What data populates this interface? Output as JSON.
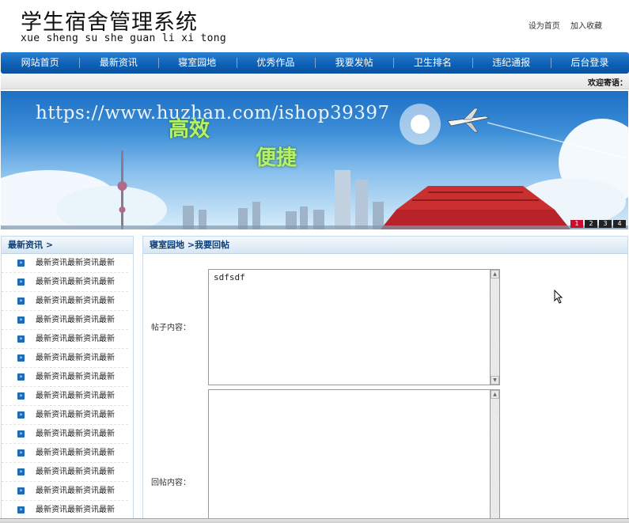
{
  "header": {
    "title": "学生宿舍管理系统",
    "pinyin": "xue sheng su she guan li xi tong",
    "links": [
      "设为首页",
      "加入收藏"
    ]
  },
  "nav": {
    "items": [
      "网站首页",
      "最新资讯",
      "寝室园地",
      "优秀作品",
      "我要发帖",
      "卫生排名",
      "违纪通报",
      "后台登录"
    ]
  },
  "welcome": {
    "text": "欢迎寄语："
  },
  "banner": {
    "watermark": "https://www.huzhan.com/ishop39397",
    "word1": "高效",
    "word2": "便捷",
    "slides": [
      "1",
      "2",
      "3",
      "4"
    ],
    "active_slide": 1
  },
  "sidebar": {
    "title": "最新资讯 >",
    "items": [
      "最新资讯最新资讯最新",
      "最新资讯最新资讯最新",
      "最新资讯最新资讯最新",
      "最新资讯最新资讯最新",
      "最新资讯最新资讯最新",
      "最新资讯最新资讯最新",
      "最新资讯最新资讯最新",
      "最新资讯最新资讯最新",
      "最新资讯最新资讯最新",
      "最新资讯最新资讯最新",
      "最新资讯最新资讯最新",
      "最新资讯最新资讯最新",
      "最新资讯最新资讯最新",
      "最新资讯最新资讯最新"
    ]
  },
  "main": {
    "breadcrumb": "寝室园地 >我要回帖",
    "post_label": "帖子内容：",
    "post_value": "sdfsdf",
    "reply_label": "回帖内容：",
    "reply_value": ""
  },
  "colors": {
    "nav_bg": "#0c5fb4",
    "active_slide": "#c8102e",
    "panel_title_text": "#0b3d78"
  }
}
